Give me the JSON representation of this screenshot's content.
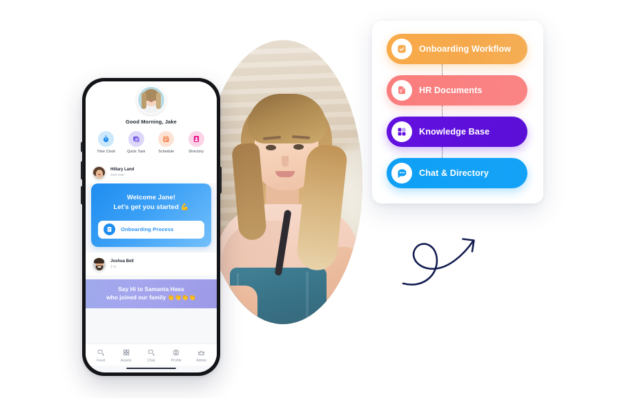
{
  "phone": {
    "greeting": "Good Morning, Jake",
    "quick_actions": [
      {
        "label": "Time Clock",
        "icon": "stopwatch-icon",
        "bg": "#cde8fb",
        "fg": "#1e8df0"
      },
      {
        "label": "Quick Task",
        "icon": "task-window-icon",
        "bg": "#ddd8f9",
        "fg": "#6a4fe0"
      },
      {
        "label": "Schedule",
        "icon": "calendar-icon",
        "bg": "#fde3d5",
        "fg": "#f68a5a"
      },
      {
        "label": "Directory",
        "icon": "id-card-icon",
        "bg": "#fbd4e8",
        "fg": "#e8158c"
      }
    ],
    "posts": [
      {
        "author": "Hillary Land",
        "time": "Just now",
        "card": {
          "title": "Welcome Jane!",
          "subtitle": "Let's get you started 💪",
          "button_label": "Onboarding Process",
          "button_icon": "document-lines-icon"
        }
      },
      {
        "author": "Joshua Bell",
        "time": "1 hr",
        "banner": {
          "line1": "Say Hi to Samanta Hass",
          "line2": "who joined our family 👏👏👏👏"
        }
      }
    ],
    "tabbar": [
      {
        "label": "Feed",
        "icon": "feed-icon"
      },
      {
        "label": "Assets",
        "icon": "grid-squares-icon"
      },
      {
        "label": "Chat",
        "icon": "chat-bubble-icon"
      },
      {
        "label": "Profile",
        "icon": "user-circle-icon"
      },
      {
        "label": "Admin",
        "icon": "crown-icon"
      }
    ]
  },
  "panel": {
    "pills": [
      {
        "label": "Onboarding Workflow",
        "icon": "check-square-icon",
        "color": "#f6a94c"
      },
      {
        "label": "HR Documents",
        "icon": "document-icon",
        "color": "#fa7d7d"
      },
      {
        "label": "Knowledge Base",
        "icon": "grid-four-icon",
        "color": "#6310e0"
      },
      {
        "label": "Chat & Directory",
        "icon": "chat-dots-icon",
        "color": "#0fa0f5"
      }
    ]
  },
  "decor": {
    "arrow": "curly-arrow-up-right",
    "arrow_color": "#141e50"
  }
}
